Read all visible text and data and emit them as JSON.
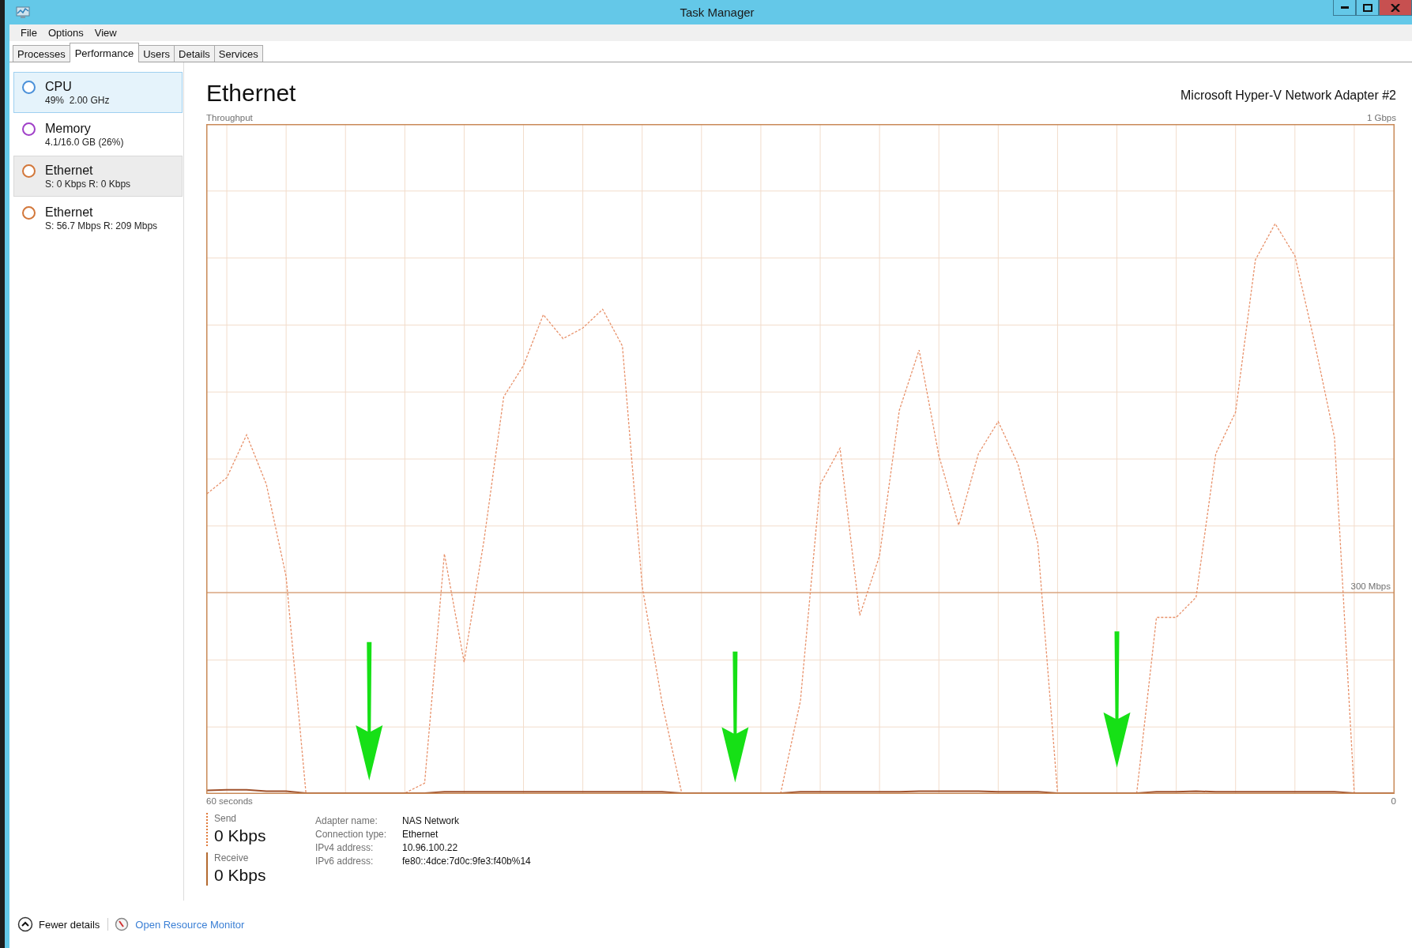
{
  "window": {
    "title": "Task Manager"
  },
  "menu": [
    "File",
    "Options",
    "View"
  ],
  "tabs": [
    {
      "label": "Processes",
      "selected": false
    },
    {
      "label": "Performance",
      "selected": true
    },
    {
      "label": "Users",
      "selected": false
    },
    {
      "label": "Details",
      "selected": false
    },
    {
      "label": "Services",
      "selected": false
    }
  ],
  "sidebar": {
    "items": [
      {
        "name": "CPU",
        "detail": "49%  2.00 GHz",
        "color": "#4a90d9",
        "selected": true,
        "hovered": false
      },
      {
        "name": "Memory",
        "detail": "4.1/16.0 GB (26%)",
        "color": "#a040c8",
        "selected": false,
        "hovered": false
      },
      {
        "name": "Ethernet",
        "detail": "S: 0 Kbps R: 0 Kbps",
        "color": "#d2773a",
        "selected": false,
        "hovered": true
      },
      {
        "name": "Ethernet",
        "detail": "S: 56.7 Mbps R: 209 Mbps",
        "color": "#d2773a",
        "selected": false,
        "hovered": false
      }
    ]
  },
  "panel": {
    "title": "Ethernet",
    "adapter": "Microsoft Hyper-V Network Adapter #2",
    "graph": {
      "label": "Throughput",
      "scale_top": "1 Gbps",
      "scale_mark": "300 Mbps",
      "time_span": "60 seconds",
      "time_end": "0"
    },
    "stats": [
      {
        "kind": "dotted",
        "label": "Send",
        "value": "0 Kbps"
      },
      {
        "kind": "solid",
        "label": "Receive",
        "value": "0 Kbps"
      }
    ],
    "properties": [
      {
        "label": "Adapter name:",
        "value": "NAS Network"
      },
      {
        "label": "Connection type:",
        "value": "Ethernet"
      },
      {
        "label": "IPv4 address:",
        "value": "10.96.100.22"
      },
      {
        "label": "IPv6 address:",
        "value": "fe80::4dce:7d0c:9fe3:f40b%14"
      }
    ]
  },
  "footer": {
    "toggle": "Fewer details",
    "link": "Open Resource Monitor"
  }
}
